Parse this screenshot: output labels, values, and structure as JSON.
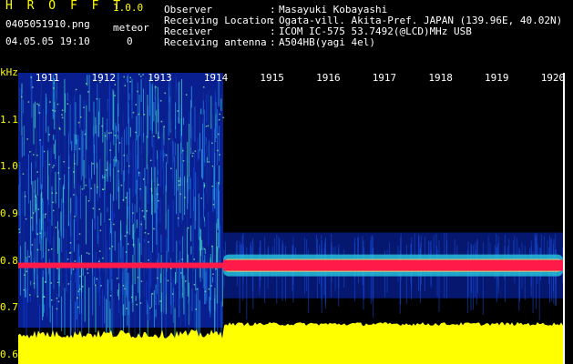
{
  "app": {
    "title": "H R O F F T",
    "version": "1.0.0",
    "file_name": "0405051910.png",
    "date_time": "04.05.05 19:10",
    "meteor_label": "meteor",
    "meteor_count": "0"
  },
  "info": [
    {
      "label": "Observer",
      "value": "Masayuki Kobayashi"
    },
    {
      "label": "Receiving Location",
      "value": "Ogata-vill. Akita-Pref. JAPAN (139.96E, 40.02N)"
    },
    {
      "label": "Receiver",
      "value": "ICOM IC-575 53.7492(@LCD)MHz USB"
    },
    {
      "label": "Receiving antenna",
      "value": "A504HB(yagi 4el)"
    }
  ],
  "separator": ":",
  "colors": {
    "label_yellow": "#ffff00",
    "text_white": "#ffffff",
    "background": "#000000",
    "echo_red": "#ff1a4a",
    "signal_yellow": "#ffff00",
    "noise_blue": "#0a2fbf"
  },
  "chart_data": {
    "type": "heatmap",
    "y_unit": "kHz",
    "y_ticks": [
      "1.1",
      "1.0",
      "0.9",
      "0.8",
      "0.7",
      "0.6"
    ],
    "x_ticks": [
      "1911",
      "1912",
      "1913",
      "1914",
      "1915",
      "1916",
      "1917",
      "1918",
      "1919",
      "1920"
    ],
    "ylim": [
      0.58,
      1.2
    ],
    "xlim": [
      1910.5,
      1920.2
    ],
    "echo_band_khz": 0.79,
    "transition_x": 1914.15
  }
}
